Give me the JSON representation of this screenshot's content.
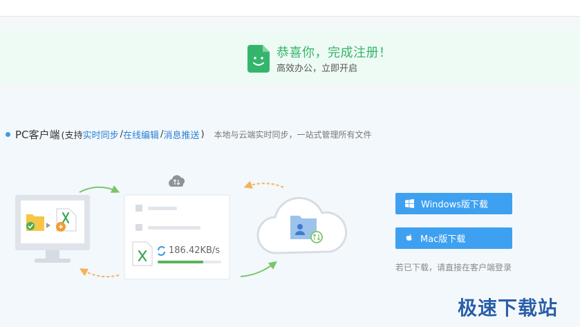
{
  "banner": {
    "title": "恭喜你，完成注册！",
    "subtitle": "高效办公，立即开启",
    "icon": "smiling-document-icon",
    "accent_color": "#34b56b"
  },
  "section": {
    "title": "PC客户端",
    "paren_open": "(支持",
    "features": [
      "实时同步",
      "在线编辑",
      "消息推送"
    ],
    "separator": "/",
    "paren_close": ")",
    "description": "本地与云端实时同步，一站式管理所有文件"
  },
  "illustration": {
    "speed": "186.42KB/s",
    "upload_progress": 0.72
  },
  "downloads": {
    "windows_label": "Windows版下载",
    "mac_label": "Mac版下载",
    "hint": "若已下载，请直接在客户端登录",
    "button_color": "#3ea0f0"
  },
  "watermark": "极速下载站"
}
